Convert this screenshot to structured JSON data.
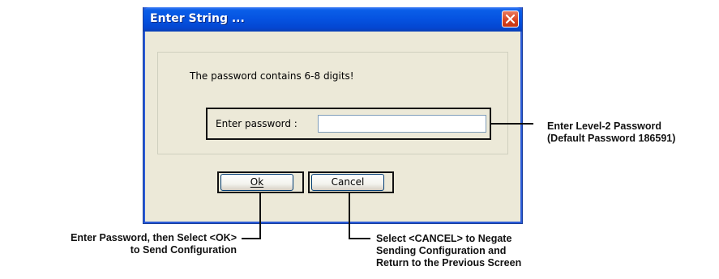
{
  "dialog": {
    "title": "Enter String ...",
    "message": "The password contains 6-8 digits!",
    "password_label": "Enter password :",
    "password_value": "",
    "ok_label": "Ok",
    "cancel_label": "Cancel",
    "close_icon": "close-icon"
  },
  "annotations": {
    "password": {
      "line1": "Enter Level-2 Password",
      "line2": "(Default Password 186591)"
    },
    "ok": {
      "line1": "Enter Password, then Select <OK>",
      "line2": "to Send Configuration"
    },
    "cancel": {
      "line1": "Select <CANCEL> to Negate",
      "line2": "Sending Configuration and",
      "line3": "Return to the Previous Screen"
    }
  },
  "colors": {
    "titlebar": "#0552e0",
    "close_button": "#d8431f",
    "dialog_background": "#ece9d8",
    "annotation_ink": "#111111"
  }
}
